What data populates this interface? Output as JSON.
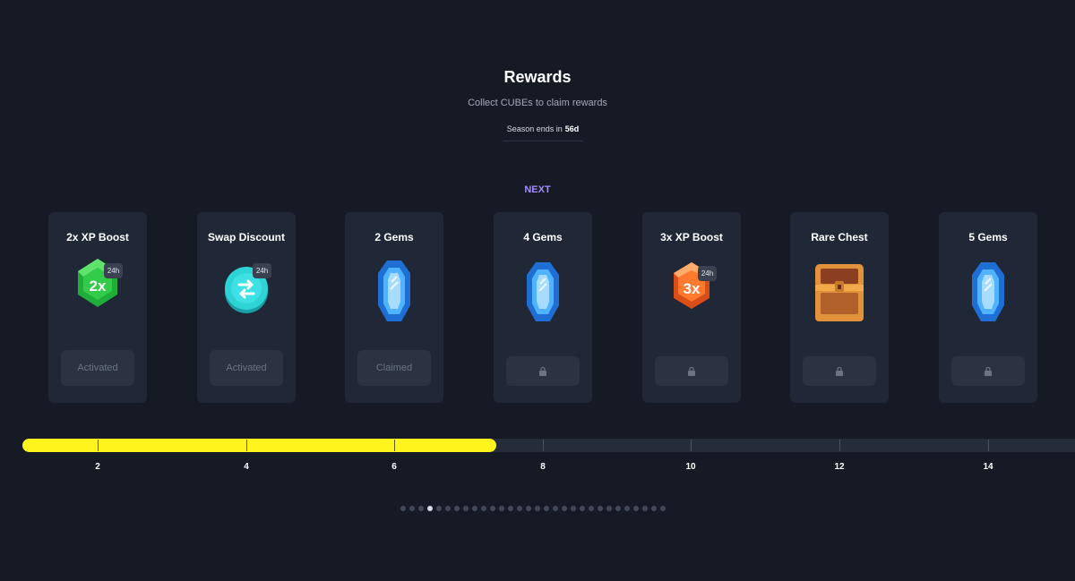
{
  "header": {
    "title": "Rewards",
    "subtitle": "Collect CUBEs to claim rewards",
    "season_prefix": "Season ends in",
    "season_value": "56d"
  },
  "next_label": "NEXT",
  "rewards": [
    {
      "title": "2x XP Boost",
      "icon": "xp-boost-2x-icon",
      "icon_text": "2x",
      "badge": "24h",
      "button": "Activated",
      "state": "activated"
    },
    {
      "title": "Swap Discount",
      "icon": "swap-discount-icon",
      "badge": "24h",
      "button": "Activated",
      "state": "activated"
    },
    {
      "title": "2 Gems",
      "icon": "gem-icon",
      "button": "Claimed",
      "state": "claimed"
    },
    {
      "title": "4 Gems",
      "icon": "gem-icon",
      "button": "",
      "state": "locked"
    },
    {
      "title": "3x XP Boost",
      "icon": "xp-boost-3x-icon",
      "icon_text": "3x",
      "badge": "24h",
      "button": "",
      "state": "locked"
    },
    {
      "title": "Rare Chest",
      "icon": "chest-icon",
      "button": "",
      "state": "locked"
    },
    {
      "title": "5 Gems",
      "icon": "gem-icon",
      "button": "",
      "state": "locked"
    }
  ],
  "progress": {
    "ticks": [
      "2",
      "4",
      "6",
      "8",
      "10",
      "12",
      "14"
    ],
    "current_value": 7
  },
  "pagination": {
    "count": 30,
    "active_index": 3
  },
  "colors": {
    "background": "#151a24",
    "card": "#202736",
    "accent_next": "#a48bff",
    "progress_fill": "#fff41b",
    "green": "#33cc4a",
    "teal": "#2ed3d6",
    "orange": "#ff7a2f",
    "gem_blue": "#2f8ff5",
    "chest": "#e2923a"
  }
}
